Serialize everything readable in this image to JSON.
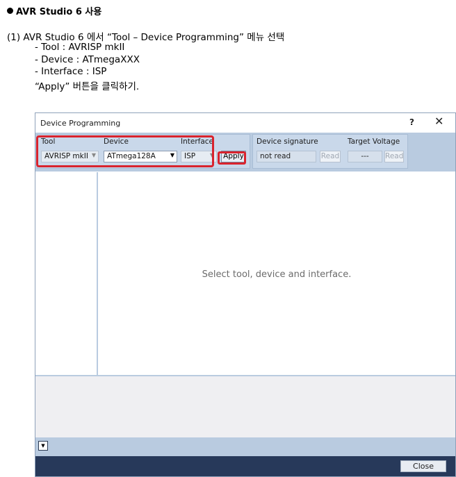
{
  "doc": {
    "heading": "AVR Studio 6 사용",
    "step": "(1) AVR Studio 6 에서 “Tool – Device Programming” 메뉴 선택",
    "lines": [
      "- Tool : AVRISP mkII",
      "- Device : ATmegaXXX",
      "- Interface : ISP",
      "“Apply” 버튼을 클릭하기."
    ]
  },
  "dialog": {
    "title": "Device Programming",
    "help_icon": "?",
    "close_icon": "✕",
    "tool_label": "Tool",
    "tool_value": "AVRISP mkII",
    "device_label": "Device",
    "device_value": "ATmega128A",
    "interface_label": "Interface",
    "interface_value": "ISP",
    "apply_label": "Apply",
    "signature_label": "Device signature",
    "signature_value": "not read",
    "signature_read": "Read",
    "voltage_label": "Target Voltage",
    "voltage_value": "---",
    "voltage_read": "Read",
    "placeholder": "Select tool, device and interface.",
    "expand_icon": "▼",
    "close_button": "Close"
  },
  "colors": {
    "highlight": "#d9232d",
    "toolbar": "#b9cbe0",
    "footer": "#27395a"
  }
}
